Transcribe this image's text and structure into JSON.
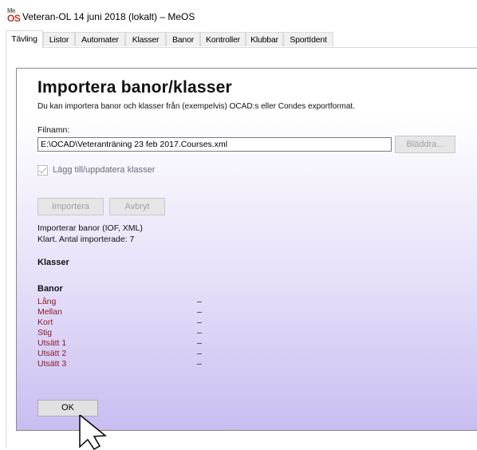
{
  "window": {
    "title": "Veteran-OL 14 juni 2018 (lokalt) – MeOS",
    "icon_top": "Me",
    "icon_bottom": "OS"
  },
  "tabs": [
    {
      "label": "Tävling",
      "active": true
    },
    {
      "label": "Listor"
    },
    {
      "label": "Automater"
    },
    {
      "label": "Klasser"
    },
    {
      "label": "Banor"
    },
    {
      "label": "Kontroller"
    },
    {
      "label": "Klubbar"
    },
    {
      "label": "SportIdent"
    }
  ],
  "dialog": {
    "heading": "Importera banor/klasser",
    "subtitle": "Du kan importera banor och klasser från (exempelvis) OCAD:s eller Condes exportformat.",
    "filename_label": "Filnamn:",
    "filename_value": "E:\\OCAD\\Veteranträning 23 feb 2017.Courses.xml",
    "browse_label": "Bläddra...",
    "checkbox_label": "Lägg till/uppdatera klasser",
    "import_label": "Importera",
    "cancel_label": "Avbryt",
    "status_line1": "Importerar banor (IOF, XML)",
    "status_line2": "Klart. Antal importerade: 7",
    "classes_heading": "Klasser",
    "courses_heading": "Banor",
    "courses": [
      {
        "name": "Lång",
        "value": "–"
      },
      {
        "name": "Mellan",
        "value": "–"
      },
      {
        "name": "Kort",
        "value": "–"
      },
      {
        "name": "Stig",
        "value": "–"
      },
      {
        "name": "Utsätt 1",
        "value": "–"
      },
      {
        "name": "Utsätt 2",
        "value": "–"
      },
      {
        "name": "Utsätt 3",
        "value": "–"
      }
    ],
    "ok_label": "OK"
  },
  "colors": {
    "course_link": "#8b1a2b",
    "panel_gradient_end": "#c9bdf1"
  }
}
